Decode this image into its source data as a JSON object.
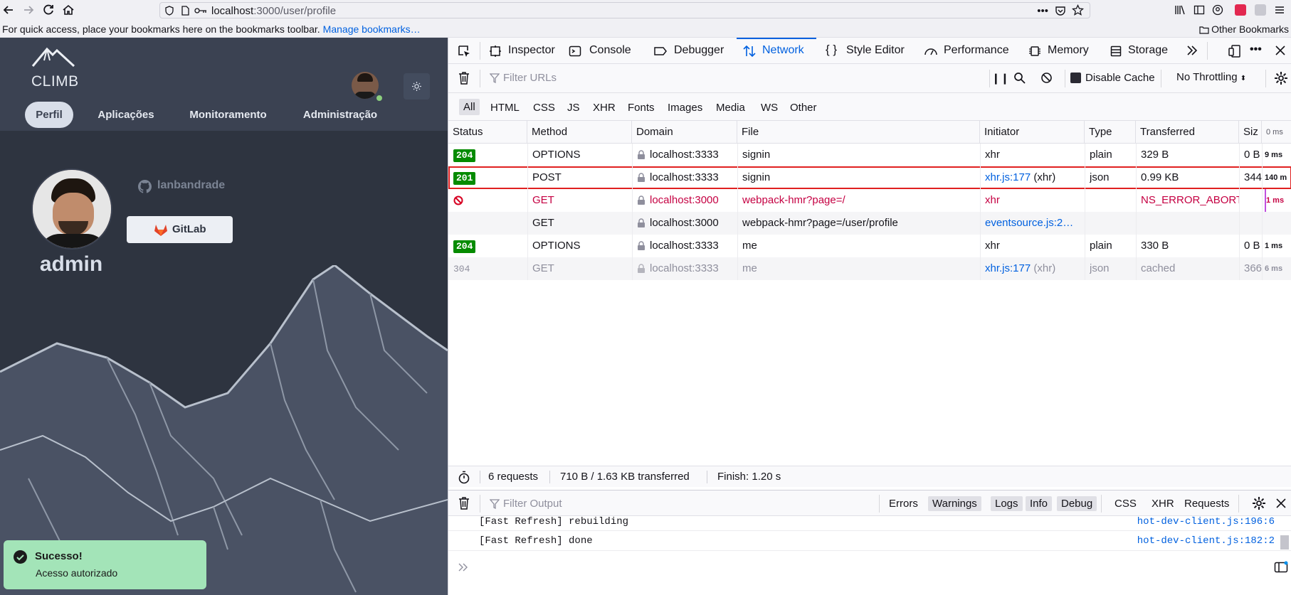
{
  "browser": {
    "url_host": "localhost",
    "url_rest": ":3000/user/profile",
    "bookmarks_hint": "For quick access, place your bookmarks here on the bookmarks toolbar.",
    "manage_bookmarks": "Manage bookmarks…",
    "other_bookmarks": "Other Bookmarks"
  },
  "app": {
    "logo": "CLIMB",
    "nav": [
      "Perfil",
      "Aplicações",
      "Monitoramento",
      "Administração"
    ],
    "profile_name": "admin",
    "github_user": "lanbandrade",
    "gitlab_button": "GitLab",
    "toast": {
      "title": "Sucesso!",
      "message": "Acesso autorizado"
    },
    "colors": {
      "background": "#2e3440",
      "nav": "#3b4252",
      "toast": "#a3e4b8"
    }
  },
  "devtools": {
    "tabs": [
      "Inspector",
      "Console",
      "Debugger",
      "Network",
      "Style Editor",
      "Performance",
      "Memory",
      "Storage"
    ],
    "active_tab": "Network",
    "filter_placeholder": "Filter URLs",
    "disable_cache": "Disable Cache",
    "throttling": "No Throttling",
    "type_filters": [
      "All",
      "HTML",
      "CSS",
      "JS",
      "XHR",
      "Fonts",
      "Images",
      "Media",
      "WS",
      "Other"
    ],
    "columns": [
      "Status",
      "Method",
      "Domain",
      "File",
      "Initiator",
      "Type",
      "Transferred",
      "Siz"
    ],
    "waterfall_header": "0 ms",
    "requests": [
      {
        "status": "204",
        "method": "OPTIONS",
        "domain": "localhost:3333",
        "file": "signin",
        "initiator": "xhr",
        "initiator_suffix": "",
        "type": "plain",
        "transferred": "329 B",
        "size": "0 B",
        "timing": "9 ms",
        "style": "normal"
      },
      {
        "status": "201",
        "method": "POST",
        "domain": "localhost:3333",
        "file": "signin",
        "initiator": "xhr.js:177",
        "initiator_suffix": " (xhr)",
        "type": "json",
        "transferred": "0.99 KB",
        "size": "344",
        "timing": "140 m",
        "style": "highlight"
      },
      {
        "status": "",
        "method": "GET",
        "domain": "localhost:3000",
        "file": "webpack-hmr?page=/",
        "initiator": "xhr",
        "initiator_suffix": "",
        "type": "",
        "transferred": "NS_ERROR_ABORT",
        "size": "",
        "timing": "1 ms",
        "style": "error"
      },
      {
        "status": "",
        "method": "GET",
        "domain": "localhost:3000",
        "file": "webpack-hmr?page=/user/profile",
        "initiator": "eventsource.js:2…",
        "initiator_suffix": "",
        "type": "",
        "transferred": "",
        "size": "",
        "timing": "",
        "style": "normal"
      },
      {
        "status": "204",
        "method": "OPTIONS",
        "domain": "localhost:3333",
        "file": "me",
        "initiator": "xhr",
        "initiator_suffix": "",
        "type": "plain",
        "transferred": "330 B",
        "size": "0 B",
        "timing": "1 ms",
        "style": "normal"
      },
      {
        "status": "304",
        "method": "GET",
        "domain": "localhost:3333",
        "file": "me",
        "initiator": "xhr.js:177",
        "initiator_suffix": " (xhr)",
        "type": "json",
        "transferred": "cached",
        "size": "366",
        "timing": "6 ms",
        "style": "cached"
      }
    ],
    "summary": {
      "requests": "6 requests",
      "transferred": "710 B / 1.63 KB transferred",
      "finish": "Finish: 1.20 s"
    },
    "console": {
      "filter_placeholder": "Filter Output",
      "filters": [
        "Errors",
        "Warnings",
        "Logs",
        "Info",
        "Debug"
      ],
      "extra_filters": [
        "CSS",
        "XHR",
        "Requests"
      ],
      "lines": [
        {
          "message": "[Fast Refresh] rebuilding",
          "source": "hot-dev-client.js:196:6"
        },
        {
          "message": "[Fast Refresh] done",
          "source": "hot-dev-client.js:182:2"
        }
      ]
    }
  }
}
